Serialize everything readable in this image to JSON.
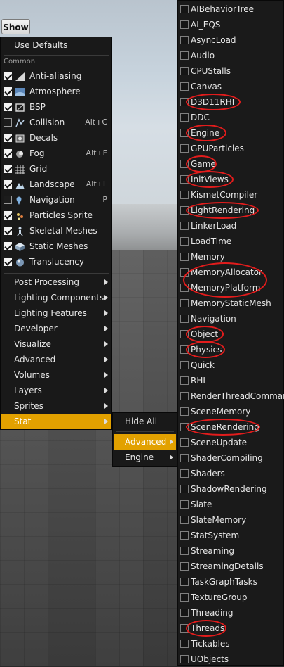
{
  "show_button": {
    "label": "Show"
  },
  "show_menu": {
    "use_defaults": "Use Defaults",
    "common_header": "Common",
    "common_items": [
      {
        "label": "Anti-aliasing",
        "shortcut": "",
        "checked": true,
        "icon": "anti-aliasing-icon"
      },
      {
        "label": "Atmosphere",
        "shortcut": "",
        "checked": true,
        "icon": "atmosphere-icon"
      },
      {
        "label": "BSP",
        "shortcut": "",
        "checked": true,
        "icon": "bsp-icon"
      },
      {
        "label": "Collision",
        "shortcut": "Alt+C",
        "checked": false,
        "icon": "collision-icon"
      },
      {
        "label": "Decals",
        "shortcut": "",
        "checked": true,
        "icon": "decals-icon"
      },
      {
        "label": "Fog",
        "shortcut": "Alt+F",
        "checked": true,
        "icon": "fog-icon"
      },
      {
        "label": "Grid",
        "shortcut": "",
        "checked": true,
        "icon": "grid-icon"
      },
      {
        "label": "Landscape",
        "shortcut": "Alt+L",
        "checked": true,
        "icon": "landscape-icon"
      },
      {
        "label": "Navigation",
        "shortcut": "P",
        "checked": false,
        "icon": "navigation-icon"
      },
      {
        "label": "Particles Sprite",
        "shortcut": "",
        "checked": true,
        "icon": "particles-sprite-icon"
      },
      {
        "label": "Skeletal Meshes",
        "shortcut": "",
        "checked": true,
        "icon": "skeletal-meshes-icon"
      },
      {
        "label": "Static Meshes",
        "shortcut": "",
        "checked": true,
        "icon": "static-meshes-icon"
      },
      {
        "label": "Translucency",
        "shortcut": "",
        "checked": true,
        "icon": "translucency-icon"
      }
    ],
    "submenus": [
      "Post Processing",
      "Lighting Components",
      "Lighting Features",
      "Developer",
      "Visualize",
      "Advanced",
      "Volumes",
      "Layers",
      "Sprites",
      "Stat"
    ],
    "selected_submenu": "Stat",
    "accent_color": "#e2a100"
  },
  "stat_menu": {
    "hide_all": "Hide All",
    "items": [
      "Advanced",
      "Engine"
    ],
    "selected": "Advanced"
  },
  "advanced_stats": [
    {
      "label": "AIBehaviorTree",
      "checked": false,
      "circled": false
    },
    {
      "label": "AI_EQS",
      "checked": false,
      "circled": false
    },
    {
      "label": "AsyncLoad",
      "checked": false,
      "circled": false
    },
    {
      "label": "Audio",
      "checked": false,
      "circled": false
    },
    {
      "label": "CPUStalls",
      "checked": false,
      "circled": false
    },
    {
      "label": "Canvas",
      "checked": false,
      "circled": false
    },
    {
      "label": "D3D11RHI",
      "checked": false,
      "circled": true
    },
    {
      "label": "DDC",
      "checked": false,
      "circled": false
    },
    {
      "label": "Engine",
      "checked": false,
      "circled": true
    },
    {
      "label": "GPUParticles",
      "checked": false,
      "circled": false
    },
    {
      "label": "Game",
      "checked": false,
      "circled": true
    },
    {
      "label": "InitViews",
      "checked": false,
      "circled": true
    },
    {
      "label": "KismetCompiler",
      "checked": false,
      "circled": false
    },
    {
      "label": "LightRendering",
      "checked": false,
      "circled": true
    },
    {
      "label": "LinkerLoad",
      "checked": false,
      "circled": false
    },
    {
      "label": "LoadTime",
      "checked": false,
      "circled": false
    },
    {
      "label": "Memory",
      "checked": false,
      "circled": false
    },
    {
      "label": "MemoryAllocator",
      "checked": false,
      "circled": true
    },
    {
      "label": "MemoryPlatform",
      "checked": false,
      "circled": true
    },
    {
      "label": "MemoryStaticMesh",
      "checked": false,
      "circled": false
    },
    {
      "label": "Navigation",
      "checked": false,
      "circled": false
    },
    {
      "label": "Object",
      "checked": false,
      "circled": true
    },
    {
      "label": "Physics",
      "checked": false,
      "circled": true
    },
    {
      "label": "Quick",
      "checked": false,
      "circled": false
    },
    {
      "label": "RHI",
      "checked": false,
      "circled": false
    },
    {
      "label": "RenderThreadCommands",
      "checked": false,
      "circled": false
    },
    {
      "label": "SceneMemory",
      "checked": false,
      "circled": false
    },
    {
      "label": "SceneRendering",
      "checked": false,
      "circled": true
    },
    {
      "label": "SceneUpdate",
      "checked": false,
      "circled": false
    },
    {
      "label": "ShaderCompiling",
      "checked": false,
      "circled": false
    },
    {
      "label": "Shaders",
      "checked": false,
      "circled": false
    },
    {
      "label": "ShadowRendering",
      "checked": false,
      "circled": false
    },
    {
      "label": "Slate",
      "checked": false,
      "circled": false
    },
    {
      "label": "SlateMemory",
      "checked": false,
      "circled": false
    },
    {
      "label": "StatSystem",
      "checked": false,
      "circled": false
    },
    {
      "label": "Streaming",
      "checked": false,
      "circled": false
    },
    {
      "label": "StreamingDetails",
      "checked": false,
      "circled": false
    },
    {
      "label": "TaskGraphTasks",
      "checked": false,
      "circled": false
    },
    {
      "label": "TextureGroup",
      "checked": false,
      "circled": false
    },
    {
      "label": "Threading",
      "checked": false,
      "circled": false
    },
    {
      "label": "Threads",
      "checked": false,
      "circled": true
    },
    {
      "label": "Tickables",
      "checked": false,
      "circled": false
    },
    {
      "label": "UObjects",
      "checked": false,
      "circled": false
    }
  ],
  "annotation_color": "#e31c1c"
}
